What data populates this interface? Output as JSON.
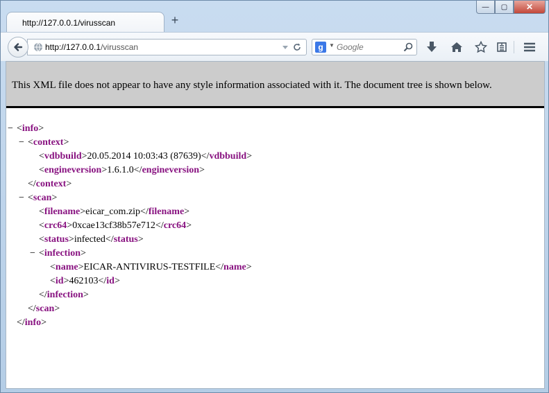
{
  "tab": {
    "title": "http://127.0.0.1/virusscan",
    "new_tab_label": "+"
  },
  "window_controls": {
    "minimize": "—",
    "maximize": "▢",
    "close": "✕"
  },
  "address_bar": {
    "scheme_host": "http://127.0.0.1",
    "path": "/virusscan"
  },
  "search_bar": {
    "engine": "g",
    "placeholder": "Google"
  },
  "toolbar_icons": [
    "download-icon",
    "home-icon",
    "bookmark-star-icon",
    "reading-list-icon",
    "hamburger-menu-icon"
  ],
  "info_message": "This XML file does not appear to have any style information associated with it. The document tree is shown below.",
  "xml_tree": {
    "toggle": "−",
    "root_tag": "info",
    "context_tag": "context",
    "vdbbuild_tag": "vdbbuild",
    "vdbbuild_value": "20.05.2014 10:03:43 (87639)",
    "engineversion_tag": "engineversion",
    "engineversion_value": "1.6.1.0",
    "scan_tag": "scan",
    "filename_tag": "filename",
    "filename_value": "eicar_com.zip",
    "crc64_tag": "crc64",
    "crc64_value": "0xcae13cf38b57e712",
    "status_tag": "status",
    "status_value": "infected",
    "infection_tag": "infection",
    "name_tag": "name",
    "name_value": "EICAR-ANTIVIRUS-TESTFILE",
    "id_tag": "id",
    "id_value": "462103"
  },
  "colors": {
    "tag": "#881280",
    "infobar_bg": "#cccccc"
  }
}
